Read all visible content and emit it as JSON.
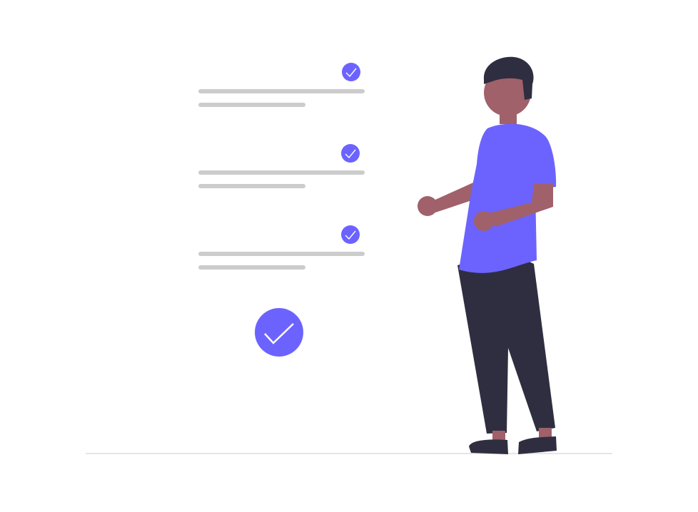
{
  "illustration": {
    "colors": {
      "accent": "#6c63ff",
      "line": "#cccccc",
      "ground": "#e6e6e6",
      "skin": "#a0616a",
      "hair": "#2f2e41",
      "pants": "#2f2e41",
      "shoes": "#2f2e41",
      "check": "#ffffff"
    },
    "checklist": {
      "items": [
        {
          "icon": "check-circle-icon",
          "checked": true
        },
        {
          "icon": "check-circle-icon",
          "checked": true
        },
        {
          "icon": "check-circle-icon",
          "checked": true
        }
      ],
      "confirm_icon": "check-circle-icon"
    },
    "figure": "person-standing"
  }
}
